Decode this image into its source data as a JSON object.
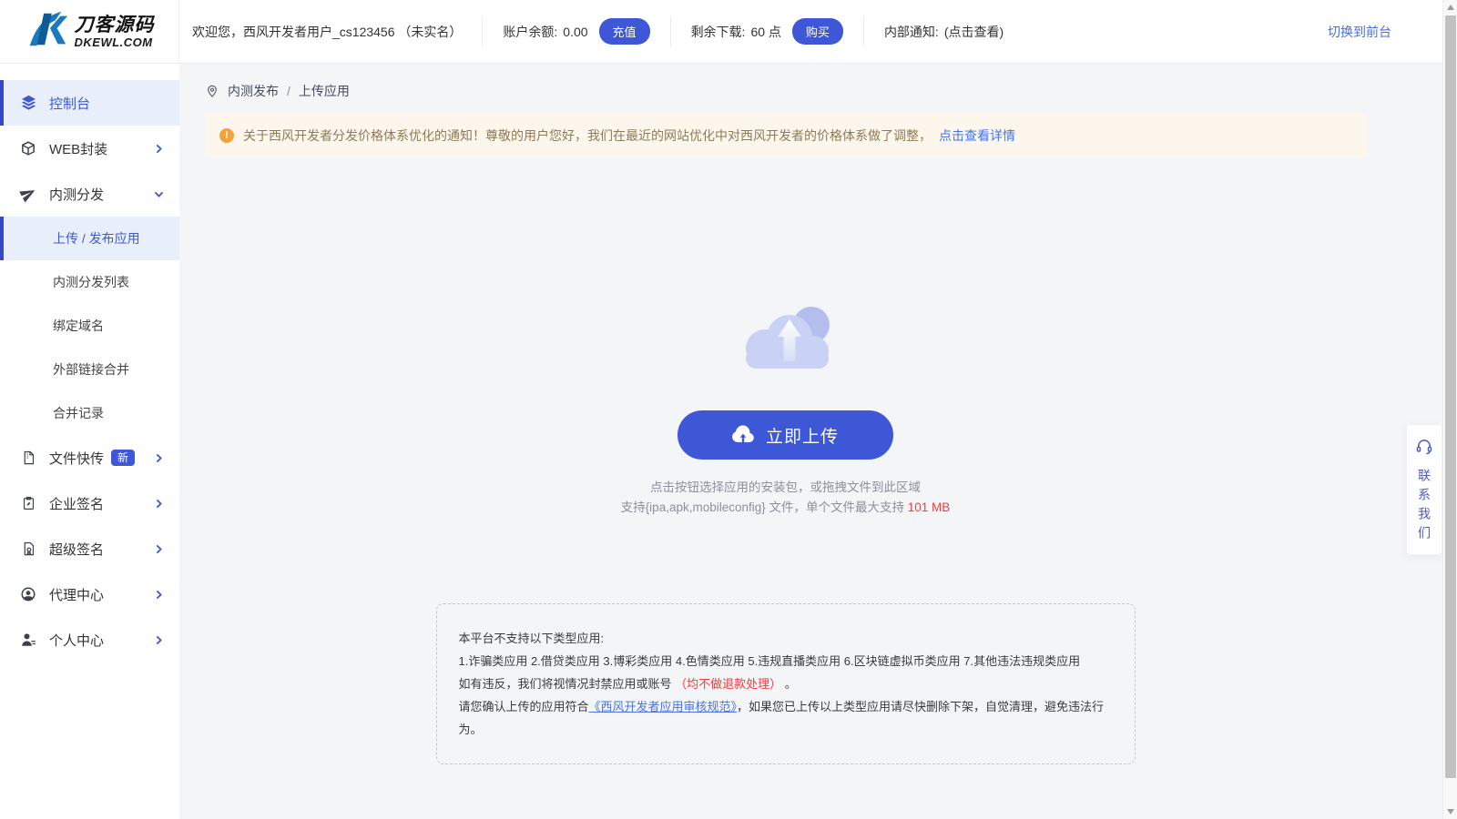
{
  "colors": {
    "primary": "#3d57d6",
    "link_blue": "#4775e0",
    "alert_red": "#f03e3e",
    "warning_bg": "#fdf6ec",
    "warning_icon": "#f0a33a",
    "sidebar_active_bg": "#e8effb",
    "sidebar_active_text": "#3d5acf"
  },
  "icons": {
    "logo_mark": "dkewl-logo-icon",
    "dashboard": "layers-icon",
    "web_pack": "package-icon",
    "distribution": "paper-plane-icon",
    "file_transfer": "zip-file-icon",
    "enterprise_sign": "clipboard-sign-icon",
    "super_sign": "certificate-icon",
    "agent": "agent-icon",
    "personal": "user-icon",
    "breadcrumb": "map-pin-icon",
    "banner": "warning-icon",
    "upload": "cloud-upload-icon",
    "contact": "headset-icon",
    "chevron_right": "chevron-right-icon",
    "chevron_down": "chevron-down-icon"
  },
  "topbar": {
    "logo": {
      "title": "刀客源码",
      "subtitle": "DKEWL.COM"
    },
    "welcome": "欢迎您，西风开发者用户_cs123456 （未实名）",
    "balance_label": "账户余额:",
    "balance_value": "0.00",
    "recharge_button": "充值",
    "downloads_label": "剩余下载:",
    "downloads_value": "60 点",
    "buy_button": "购买",
    "notice_label": "内部通知:",
    "notice_link": "(点击查看)",
    "switch_link": "切换到前台"
  },
  "sidebar": {
    "items": [
      {
        "label": "控制台",
        "icon": "layers-icon",
        "active": true
      },
      {
        "label": "WEB封装",
        "icon": "package-icon",
        "chevron": "right"
      },
      {
        "label": "内测分发",
        "icon": "paper-plane-icon",
        "chevron": "down",
        "expanded": true
      },
      {
        "label": "文件快传",
        "icon": "zip-file-icon",
        "badge": "新",
        "chevron": "right"
      },
      {
        "label": "企业签名",
        "icon": "clipboard-sign-icon",
        "chevron": "right"
      },
      {
        "label": "超级签名",
        "icon": "certificate-icon",
        "chevron": "right"
      },
      {
        "label": "代理中心",
        "icon": "agent-icon",
        "chevron": "right"
      },
      {
        "label": "个人中心",
        "icon": "user-icon",
        "chevron": "right"
      }
    ],
    "subitems": [
      {
        "label": "上传 / 发布应用",
        "active": true
      },
      {
        "label": "内测分发列表"
      },
      {
        "label": "绑定域名"
      },
      {
        "label": "外部链接合并"
      },
      {
        "label": "合并记录"
      }
    ]
  },
  "breadcrumb": {
    "section": "内测发布",
    "separator": "/",
    "page": "上传应用"
  },
  "banner": {
    "text": "关于西风开发者分发价格体系优化的通知！尊敬的用户您好，我们在最近的网站优化中对西风开发者的价格体系做了调整，",
    "link": "点击查看详情"
  },
  "upload": {
    "button_label": "立即上传",
    "hint_line1": "点击按钮选择应用的安装包，或拖拽文件到此区域",
    "hint_line2_prefix": "支持{ipa,apk,mobileconfig} 文件，单个文件最大支持 ",
    "hint_line2_highlight": "101 MB"
  },
  "rules": {
    "line1": "本平台不支持以下类型应用:",
    "line2": "1.诈骗类应用 2.借贷类应用 3.博彩类应用 4.色情类应用 5.违规直播类应用 6.区块链虚拟币类应用 7.其他违法违规类应用",
    "line3_prefix": "如有违反，我们将视情况封禁应用或账号 ",
    "line3_red": "（均不做退款处理）",
    "line3_suffix": " 。",
    "line4_prefix": "请您确认上传的应用符合",
    "line4_link": "《西风开发者应用审核规范》",
    "line4_suffix": "，如果您已上传以上类型应用请尽快删除下架，自觉清理，避免违法行为。"
  },
  "contact": {
    "label": "联系我们"
  }
}
